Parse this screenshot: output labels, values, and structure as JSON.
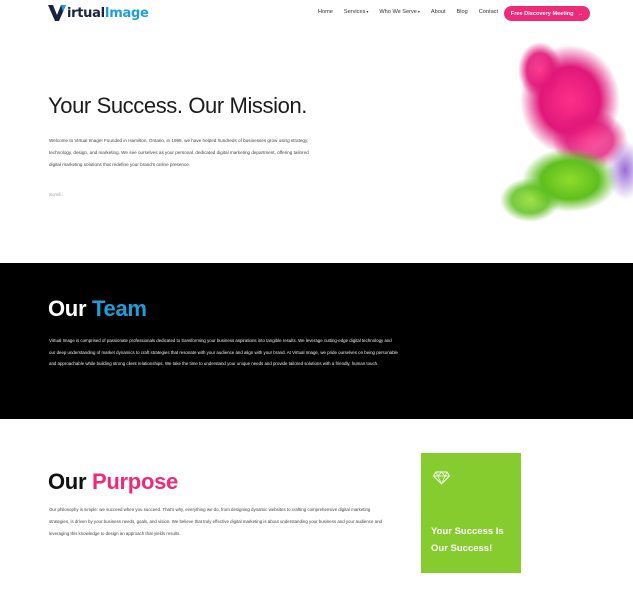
{
  "brand": {
    "logo_mark": "V",
    "logo_text_a": "irtual",
    "logo_text_b": "Image",
    "colors": {
      "navy": "#1a2340",
      "blue": "#1f9fd9",
      "pink": "#ee2a79",
      "green": "#86cc2e"
    }
  },
  "nav": {
    "items": [
      "Home",
      "Services",
      "Who We Serve",
      "About",
      "Blog",
      "Contact"
    ],
    "dropdown_items": [
      "Services",
      "Who We Serve"
    ],
    "cta_label": "Free Discovery Meeting",
    "cta_icon": "arrow-right-icon"
  },
  "hero": {
    "title": "Your Success. Our Mission.",
    "text": "Welcome to Virtual Image! Founded in Hamilton, Ontario, in 1995, we have helped hundreds of businesses grow using strategy, technology, design, and marketing. We see ourselves as your personal, dedicated digital marketing department, offering tailored digital marketing solutions that redefine your brand's online presence.",
    "scroll_label": "Scroll",
    "scroll_icon": "arrow-down-icon"
  },
  "team": {
    "title_a": "Our",
    "title_b": "Team",
    "text": "Virtual Image is comprised of passionate professionals dedicated to transforming your business aspirations into tangible results. We leverage cutting-edge digital technology and our deep understanding of market dynamics to craft strategies that resonate with your audience and align with your brand. At Virtual Image, we pride ourselves on being personable and approachable while building strong client relationships. We take the time to understand your unique needs and provide tailored solutions with a friendly, human touch."
  },
  "purpose": {
    "title_a": "Our",
    "title_b": "Purpose",
    "text": "Our philosophy is simple: we succeed when you succeed. That's why, everything we do, from designing dynamic websites to crafting comprehensive digital marketing strategies, is driven by your business needs, goals, and vision. We believe that truly effective digital marketing is about understanding your business and your audience and leveraging this knowledge to design an approach that yields results.",
    "card_text": "Your Success Is Our Success!",
    "card_icon": "diamond-icon"
  }
}
